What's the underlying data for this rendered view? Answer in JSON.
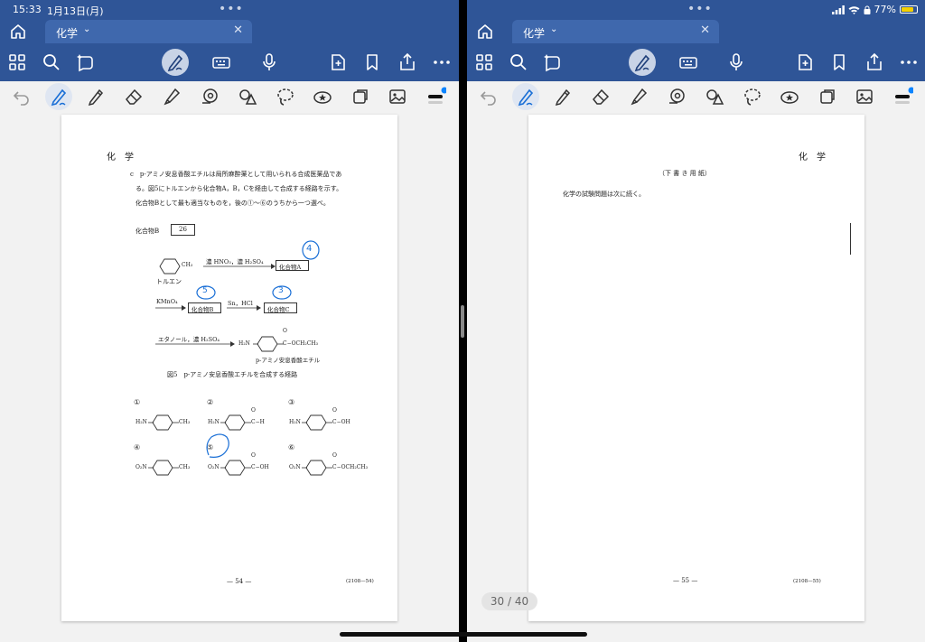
{
  "status": {
    "time": "15:33",
    "date": "1月13日(月)",
    "battery": "77%"
  },
  "left": {
    "tab_label": "化学",
    "doc": {
      "header": "化　学",
      "q_c_line1": "c　p-アミノ安息香酸エチルは局所麻酔薬として用いられる合成医薬品であ",
      "q_c_line2": "る。図5にトルエンから化合物A，B，Cを経由して合成する経路を示す。",
      "q_c_line3": "化合物Bとして最も適当なものを，後の①～⑥のうちから一つ選べ。",
      "answer_label": "化合物B",
      "answer_num": "26",
      "toluene_label": "トルエン",
      "ch3": "CH₃",
      "reagent1": "濃 HNO₃，濃 H₂SO₄",
      "cmpdA": "化合物A",
      "reagent2": "KMnO₄",
      "cmpdB": "化合物B",
      "reagent3": "Sn，HCl",
      "cmpdC": "化合物C",
      "reagent4": "エタノール，濃 H₂SO₄",
      "product_left": "H₂N",
      "product_right": "C−OCH₂CH₃",
      "product_o": "O",
      "product_name": "p-アミノ安息香酸エチル",
      "fig_caption": "図5　p-アミノ安息香酸エチルを合成する経路",
      "choices": [
        {
          "num": "①",
          "left": "H₂N",
          "right": "CH₃",
          "o": ""
        },
        {
          "num": "②",
          "left": "H₂N",
          "right": "C−H",
          "o": "O"
        },
        {
          "num": "③",
          "left": "H₂N",
          "right": "C−OH",
          "o": "O"
        },
        {
          "num": "④",
          "left": "O₂N",
          "right": "CH₃",
          "o": ""
        },
        {
          "num": "⑤",
          "left": "O₂N",
          "right": "C−OH",
          "o": "O"
        },
        {
          "num": "⑥",
          "left": "O₂N",
          "right": "C−OCH₂CH₃",
          "o": "O"
        }
      ],
      "hand_4": "4",
      "hand_5": "5",
      "hand_3": "3",
      "footer_page": "— 54 —",
      "footer_code": "(2108—54)"
    }
  },
  "right": {
    "tab_label": "化学",
    "doc": {
      "header": "化　学",
      "draft": "（下 書 き 用 紙）",
      "note": "化学の試験問題は次に続く。",
      "footer_page": "— 55 —",
      "footer_code": "(2108—55)"
    }
  },
  "page_counter": "30 / 40",
  "colors": {
    "accent": "#2f5597",
    "pen": "#1a6fd6",
    "active_dot": "#0a84ff"
  }
}
